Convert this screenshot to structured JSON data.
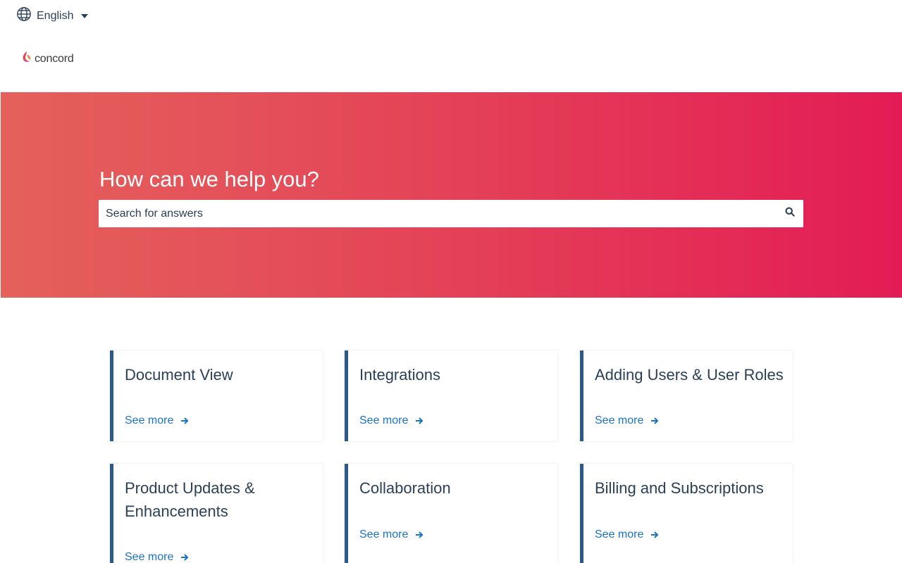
{
  "language": {
    "current": "English"
  },
  "logo": {
    "text": "concord"
  },
  "hero": {
    "title": "How can we help you?",
    "search_placeholder": "Search for answers"
  },
  "categories": [
    {
      "title": "Document View",
      "link": "See more"
    },
    {
      "title": "Integrations",
      "link": "See more"
    },
    {
      "title": "Adding Users & User Roles",
      "link": "See more"
    },
    {
      "title": "Product Updates & Enhancements",
      "link": "See more"
    },
    {
      "title": "Collaboration",
      "link": "See more"
    },
    {
      "title": "Billing and Subscriptions",
      "link": "See more"
    }
  ],
  "colors": {
    "hero_start": "#e4615b",
    "hero_end": "#e31c55",
    "card_accent": "#2b5a86",
    "link": "#1a73c9",
    "text": "#2b3f57"
  }
}
